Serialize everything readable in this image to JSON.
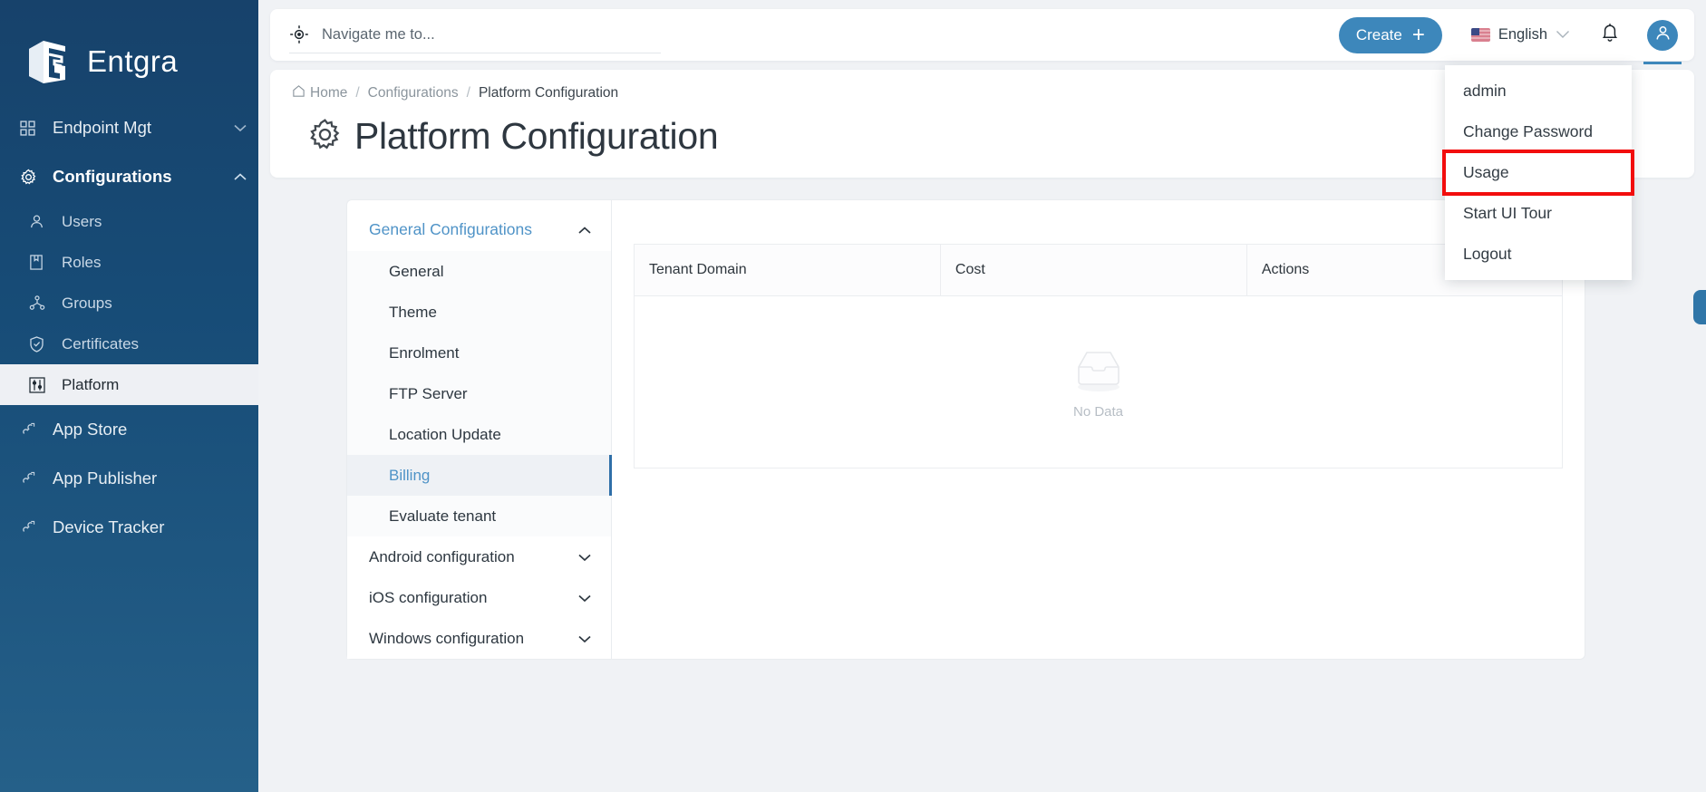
{
  "brand": {
    "name": "Entgra",
    "logo_icon": "entgra-cube-logo"
  },
  "sidebar": {
    "items": [
      {
        "label": "Endpoint Mgt",
        "icon": "grid-icon",
        "chevron": "chevron-down-icon",
        "type": "top"
      },
      {
        "label": "Configurations",
        "icon": "gear-icon",
        "chevron": "chevron-up-icon",
        "type": "top-active"
      },
      {
        "label": "Users",
        "icon": "user-icon",
        "type": "sub"
      },
      {
        "label": "Roles",
        "icon": "book-icon",
        "type": "sub"
      },
      {
        "label": "Groups",
        "icon": "groups-icon",
        "type": "sub"
      },
      {
        "label": "Certificates",
        "icon": "shield-check-icon",
        "type": "sub"
      },
      {
        "label": "Platform",
        "icon": "sliders-icon",
        "type": "sub-selected"
      },
      {
        "label": "App Store",
        "icon": "link-icon",
        "type": "top"
      },
      {
        "label": "App Publisher",
        "icon": "link-icon",
        "type": "top"
      },
      {
        "label": "Device Tracker",
        "icon": "link-icon",
        "type": "top"
      }
    ]
  },
  "topbar": {
    "search": {
      "placeholder": "Navigate me to...",
      "value": "",
      "icon": "gps-crosshair-icon"
    },
    "create_label": "Create",
    "create_plus": "+",
    "language": {
      "label": "English",
      "flag": "us-flag-icon",
      "chevron": "chevron-down-icon"
    },
    "bell_icon": "notification-bell-icon",
    "avatar_icon": "user-avatar-icon"
  },
  "user_menu": {
    "items": [
      {
        "label": "admin",
        "highlighted": false
      },
      {
        "label": "Change Password",
        "highlighted": false
      },
      {
        "label": "Usage",
        "highlighted": true
      },
      {
        "label": "Start UI Tour",
        "highlighted": false
      },
      {
        "label": "Logout",
        "highlighted": false
      }
    ]
  },
  "breadcrumb": {
    "home": "Home",
    "home_icon": "home-icon",
    "sep": "/",
    "middle": "Configurations",
    "current": "Platform Configuration"
  },
  "page": {
    "title": "Platform Configuration",
    "title_icon": "gear-icon"
  },
  "config_panel": {
    "header": {
      "label": "General Configurations",
      "chevron": "chevron-up-icon"
    },
    "items": [
      {
        "label": "General",
        "active": false
      },
      {
        "label": "Theme",
        "active": false
      },
      {
        "label": "Enrolment",
        "active": false
      },
      {
        "label": "FTP Server",
        "active": false
      },
      {
        "label": "Location Update",
        "active": false
      },
      {
        "label": "Billing",
        "active": true
      },
      {
        "label": "Evaluate tenant",
        "active": false
      }
    ],
    "groups": [
      {
        "label": "Android configuration",
        "chevron": "chevron-down-icon"
      },
      {
        "label": "iOS configuration",
        "chevron": "chevron-down-icon"
      },
      {
        "label": "Windows configuration",
        "chevron": "chevron-down-icon"
      }
    ]
  },
  "table": {
    "columns": [
      "Tenant Domain",
      "Cost",
      "Actions"
    ],
    "rows": [],
    "empty_label": "No Data",
    "empty_icon": "empty-inbox-icon"
  },
  "colors": {
    "sidebar_top": "#17426b",
    "sidebar_bottom": "#256089",
    "accent": "#3d87bb",
    "link": "#4f93c7",
    "highlight_box": "#f20d0d",
    "page_bg": "#f0f2f5"
  }
}
